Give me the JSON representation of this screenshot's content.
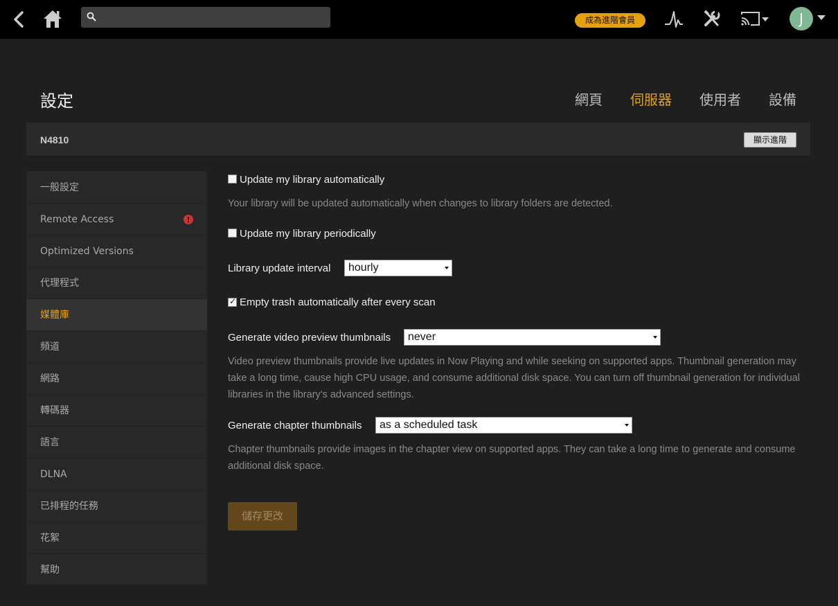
{
  "topbar": {
    "search_placeholder": "",
    "premium_label": "成為進階會員",
    "avatar_letter": "J",
    "icons": [
      "back-icon",
      "home-icon",
      "search-icon",
      "activity-icon",
      "tools-icon",
      "cast-icon",
      "avatar"
    ]
  },
  "header": {
    "title": "設定",
    "tabs": [
      {
        "label": "網頁",
        "active": false
      },
      {
        "label": "伺服器",
        "active": true
      },
      {
        "label": "使用者",
        "active": false
      },
      {
        "label": "設備",
        "active": false
      }
    ]
  },
  "server": {
    "name": "N4810",
    "advanced_label": "顯示進階"
  },
  "sidebar": {
    "items": [
      {
        "label": "一般設定",
        "active": false
      },
      {
        "label": "Remote Access",
        "active": false,
        "alert": true
      },
      {
        "label": "Optimized Versions",
        "active": false
      },
      {
        "label": "代理程式",
        "active": false
      },
      {
        "label": "媒體庫",
        "active": true
      },
      {
        "label": "頻道",
        "active": false
      },
      {
        "label": "網路",
        "active": false
      },
      {
        "label": "轉碼器",
        "active": false
      },
      {
        "label": "語言",
        "active": false
      },
      {
        "label": "DLNA",
        "active": false
      },
      {
        "label": "已排程的任務",
        "active": false
      },
      {
        "label": "花絮",
        "active": false
      },
      {
        "label": "幫助",
        "active": false
      }
    ]
  },
  "settings": {
    "auto_update": {
      "label": "Update my library automatically",
      "checked": false,
      "help": "Your library will be updated automatically when changes to library folders are detected."
    },
    "periodic_update": {
      "label": "Update my library periodically",
      "checked": false
    },
    "update_interval": {
      "label": "Library update interval",
      "value": "hourly"
    },
    "empty_trash": {
      "label": "Empty trash automatically after every scan",
      "checked": true
    },
    "video_thumbnails": {
      "label": "Generate video preview thumbnails",
      "value": "never",
      "help": "Video preview thumbnails provide live updates in Now Playing and while seeking on supported apps. Thumbnail generation may take a long time, cause high CPU usage, and consume additional disk space. You can turn off thumbnail generation for individual libraries in the library's advanced settings."
    },
    "chapter_thumbnails": {
      "label": "Generate chapter thumbnails",
      "value": "as a scheduled task",
      "help": "Chapter thumbnails provide images in the chapter view on supported apps. They can take a long time to generate and consume additional disk space."
    },
    "save_label": "儲存更改"
  },
  "colors": {
    "accent": "#e5a00d",
    "background": "#1f1f1f",
    "topbar": "#000000",
    "sidebar": "#282828",
    "alert": "#cc3333"
  }
}
